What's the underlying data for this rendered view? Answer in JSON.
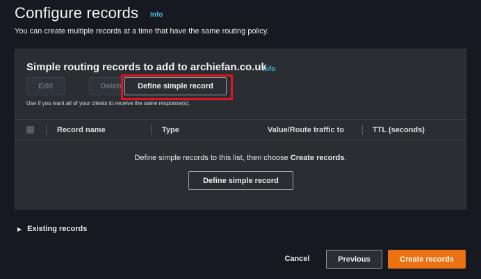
{
  "header": {
    "title": "Configure records",
    "info_label": "Info",
    "description": "You can create multiple records at a time that have the same routing policy."
  },
  "container": {
    "title": "Simple routing records to add to archiefan.co.uk",
    "info_label": "Info",
    "buttons": {
      "edit": "Edit",
      "delete": "Delete",
      "define": "Define simple record"
    },
    "note": "Use if you want all of your clients to receive the same response(s).",
    "table": {
      "columns": [
        "Record name",
        "Type",
        "Value/Route traffic to",
        "TTL (seconds)"
      ]
    },
    "empty": {
      "text_before": "Define simple records to this list, then choose ",
      "text_bold": "Create records",
      "text_after": ".",
      "button": "Define simple record"
    }
  },
  "existing_records": {
    "label": "Existing records"
  },
  "footer": {
    "cancel": "Cancel",
    "previous": "Previous",
    "create": "Create records"
  },
  "colors": {
    "background": "#16191f",
    "panel": "#2a2e33",
    "accent": "#ec7211",
    "info_link": "#44b9d6",
    "highlight": "#e3131f"
  }
}
